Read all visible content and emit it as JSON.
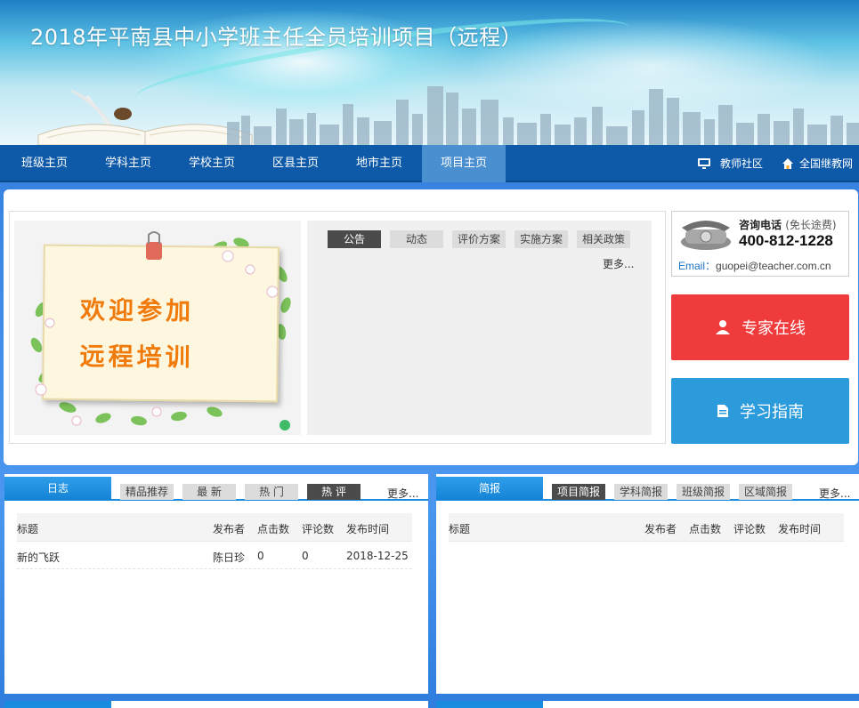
{
  "banner": {
    "title": "2018年平南县中小学班主任全员培训项目（远程）"
  },
  "nav": {
    "items": [
      "班级主页",
      "学科主页",
      "学校主页",
      "区县主页",
      "地市主页",
      "项目主页"
    ],
    "active_index": 5,
    "right_links": [
      {
        "label": "教师社区",
        "icon": "monitor-icon"
      },
      {
        "label": "全国继教网",
        "icon": "home-icon"
      }
    ]
  },
  "welcome": {
    "line1": "欢迎参加",
    "line2": "远程培训"
  },
  "news": {
    "tabs": [
      "公告",
      "动态",
      "评价方案",
      "实施方案",
      "相关政策"
    ],
    "active_tab": 0,
    "more": "更多..."
  },
  "contact": {
    "title": "咨询电话",
    "note": "(免长途费)",
    "phone": "400-812-1228",
    "email_label": "Email：",
    "email": "guopei@teacher.com.cn"
  },
  "buttons": {
    "expert": "专家在线",
    "guide": "学习指南"
  },
  "blog_panel": {
    "title": "日志",
    "tabs": [
      "精品推荐",
      "最 新",
      "热 门",
      "热 评"
    ],
    "active_tab": 3,
    "more": "更多...",
    "columns": [
      "标题",
      "发布者",
      "点击数",
      "评论数",
      "发布时间"
    ],
    "rows": [
      [
        "新的飞跃",
        "陈日珍",
        "0",
        "0",
        "2018-12-25"
      ]
    ]
  },
  "brief_panel": {
    "title": "简报",
    "tabs": [
      "项目简报",
      "学科简报",
      "班级简报",
      "区域简报"
    ],
    "active_tab": 0,
    "more": "更多...",
    "columns": [
      "标题",
      "发布者",
      "点击数",
      "评论数",
      "发布时间"
    ],
    "rows": []
  },
  "colors": {
    "nav_bg": "#0e5aa8",
    "nav_active": "#4a8fd0",
    "expert_red": "#ef3b3c",
    "guide_blue": "#2b9bdb",
    "accent": "#1a8ce0"
  }
}
